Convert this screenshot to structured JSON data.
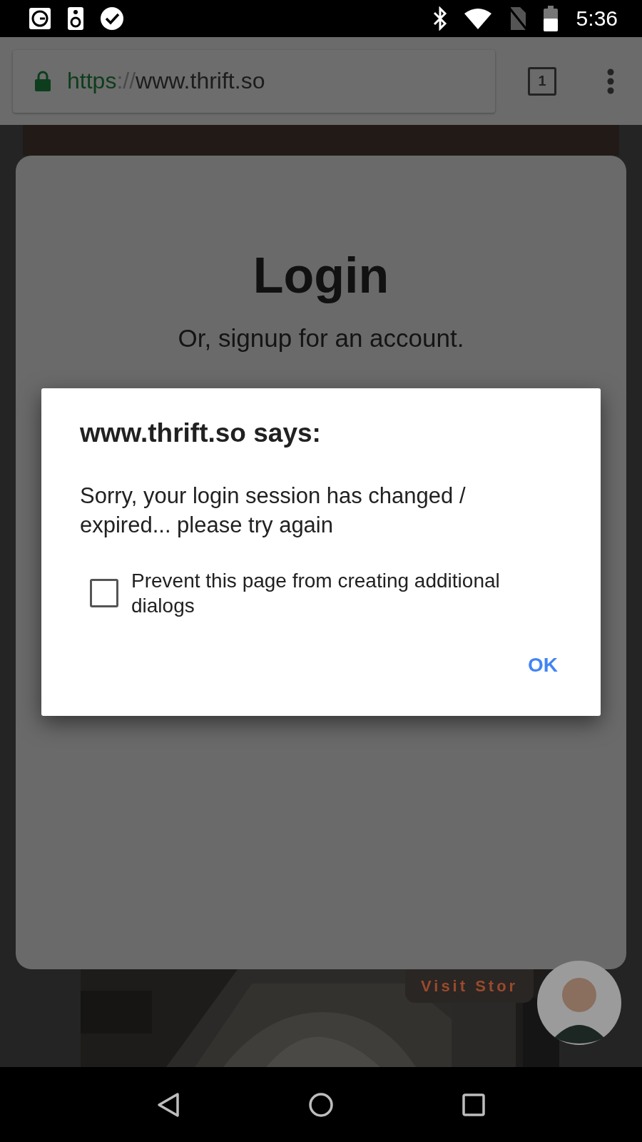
{
  "status_bar": {
    "time": "5:36"
  },
  "browser": {
    "url": {
      "scheme": "https",
      "separator": "://",
      "host": "www.thrift.so"
    },
    "tab_count": "1"
  },
  "login_card": {
    "title": "Login",
    "subtitle": "Or, signup for an account."
  },
  "visit_button": {
    "label": "Visit Stor"
  },
  "dialog": {
    "title": "www.thrift.so says:",
    "message": "Sorry, your login session has changed / expired... please try again",
    "checkbox": {
      "label": "Prevent this page from creating additional dialogs",
      "checked": false
    },
    "button": "OK"
  }
}
